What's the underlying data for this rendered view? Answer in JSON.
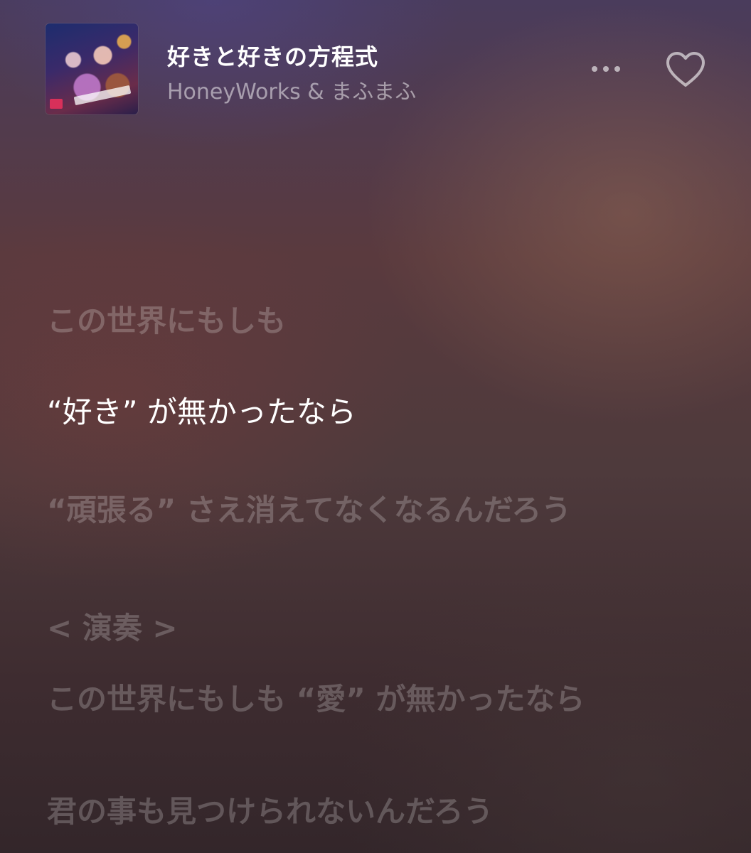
{
  "now_playing": {
    "title": "好きと好きの方程式",
    "artist": "HoneyWorks & まふまふ",
    "artwork_icon": "album-artwork",
    "more_icon": "ellipsis-icon",
    "favorite_icon": "heart-outline-icon",
    "favorited": false
  },
  "lyrics": {
    "active_index": 1,
    "lines": [
      {
        "text": "この世界にもしも"
      },
      {
        "text": "“好き” が無かったなら"
      },
      {
        "text": "“頑張る” さえ消えてなくなるんだろう"
      },
      {
        "text": "< 演奏 >"
      },
      {
        "text": "この世界にもしも “愛” が無かったなら"
      },
      {
        "text": "君の事も見つけられないんだろう"
      }
    ]
  },
  "colors": {
    "active_lyric": "#ffffff",
    "inactive_lyric": "rgba(255,255,255,0.22)",
    "secondary_text": "rgba(255,255,255,0.5)"
  }
}
